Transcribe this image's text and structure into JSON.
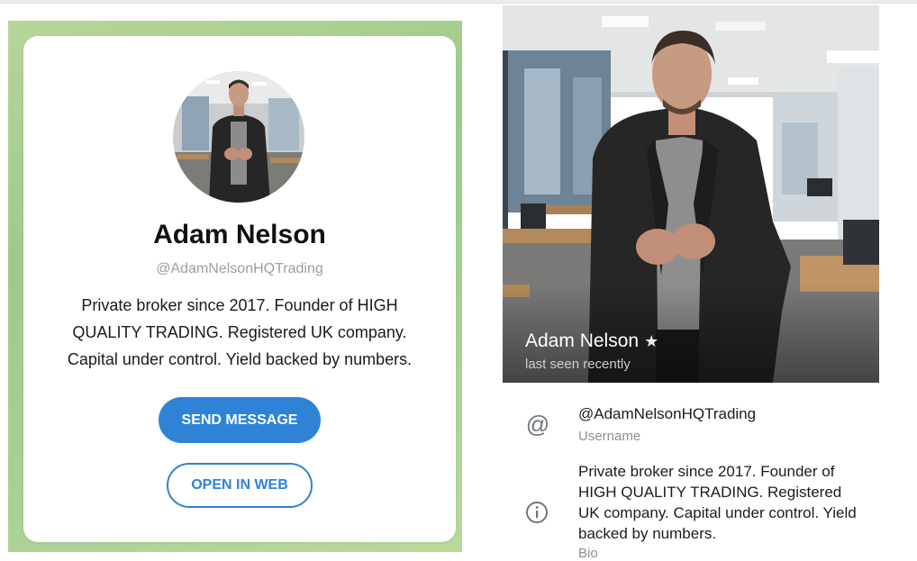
{
  "card": {
    "name": "Adam Nelson",
    "username": "@AdamNelsonHQTrading",
    "bio": "Private broker since 2017. Founder of HIGH QUALITY TRADING. Registered UK company. Capital under control. Yield backed by numbers.",
    "send_message_label": "SEND MESSAGE",
    "open_in_web_label": "OPEN IN WEB",
    "accent_color": "#2e83d6"
  },
  "profile": {
    "name": "Adam Nelson",
    "star_icon": "star-icon",
    "status": "last seen recently",
    "username": "@AdamNelsonHQTrading",
    "username_label": "Username",
    "username_icon": "at-sign-icon",
    "bio": "Private broker since 2017. Founder of HIGH QUALITY TRADING. Registered UK company. Capital under control. Yield backed by numbers.",
    "bio_label": "Bio",
    "bio_icon": "info-icon"
  }
}
